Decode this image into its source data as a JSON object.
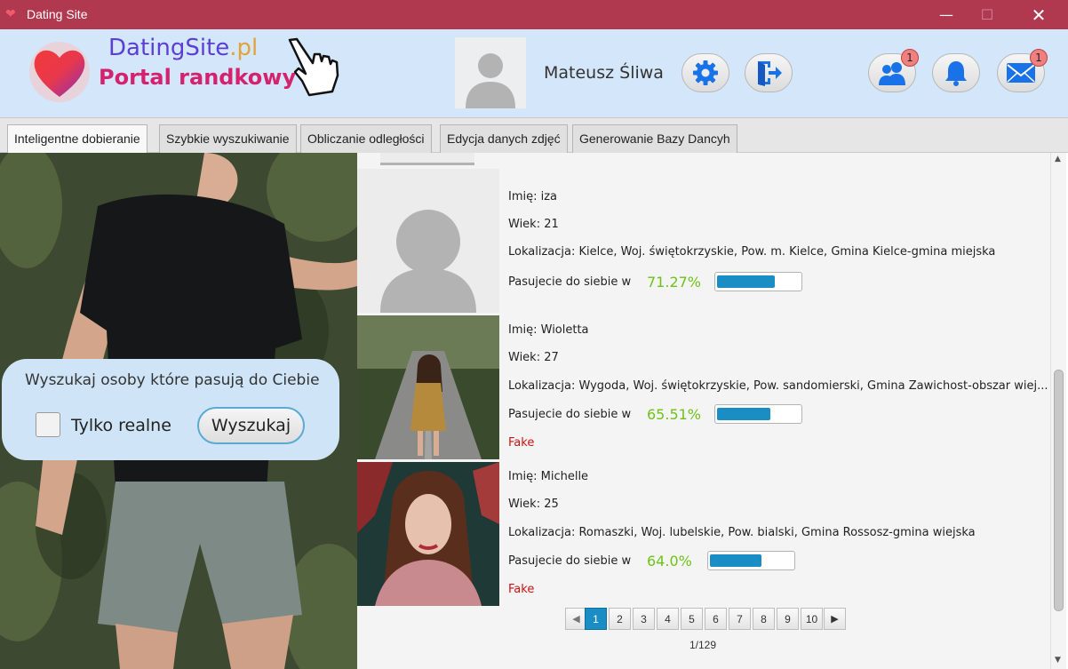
{
  "window": {
    "title": "Dating Site",
    "minimize_glyph": "—",
    "maximize_glyph": "☐",
    "close_glyph": "✕",
    "icon": "heart-icon"
  },
  "header": {
    "brand_name": "DatingSite",
    "brand_tld": ".pl",
    "brand_subtitle": "Portal randkowy",
    "user_name": "Mateusz Śliwa",
    "buttons": [
      {
        "icon": "gear-icon",
        "badge": ""
      },
      {
        "icon": "logout-icon",
        "badge": ""
      },
      {
        "icon": "users-icon",
        "badge": "1"
      },
      {
        "icon": "bell-icon",
        "badge": ""
      },
      {
        "icon": "envelope-icon",
        "badge": "1"
      }
    ],
    "colors": {
      "header_bg": "#d4e6fa",
      "titlebar_bg": "#b0394f",
      "brand_blue": "#5b3fd4",
      "brand_orange": "#e3a33b",
      "brand_pink": "#d4226e",
      "icon_blue": "#1a72e8"
    }
  },
  "tabs": [
    {
      "label": "Inteligentne dobieranie",
      "active": true
    },
    {
      "label": "Szybkie wyszukiwanie",
      "active": false
    },
    {
      "label": "Obliczanie odległości",
      "active": false
    },
    {
      "label": "Edycja danych zdjęć",
      "active": false
    },
    {
      "label": "Generowanie Bazy Dancyh",
      "active": false
    }
  ],
  "search": {
    "title": "Wyszukaj osoby które pasują do Ciebie",
    "checkbox_label": "Tylko realne",
    "checkbox_checked": false,
    "button_label": "Wyszukaj"
  },
  "results": [
    {
      "name_label": "Imię: iza",
      "age_label": "Wiek: 21",
      "location_label": "Lokalizacja: Kielce, Woj. świętokrzyskie, Pow. m. Kielce, Gmina Kielce-gmina miejska",
      "match_label": "Pasujecie do siebie w",
      "match_percent": "71.27%",
      "match_fraction": 0.7127,
      "fake_label": "",
      "photo": "placeholder-avatar"
    },
    {
      "name_label": "Imię: Wioletta",
      "age_label": "Wiek: 27",
      "location_label": "Lokalizacja: Wygoda, Woj. świętokrzyskie, Pow. sandomierski, Gmina Zawichost-obszar wiej...",
      "match_label": "Pasujecie do siebie w",
      "match_percent": "65.51%",
      "match_fraction": 0.6551,
      "fake_label": "Fake",
      "photo": "woman-on-road-photo"
    },
    {
      "name_label": "Imię: Michelle",
      "age_label": "Wiek: 25",
      "location_label": "Lokalizacja: Romaszki, Woj. lubelskie, Pow. bialski, Gmina Rossosz-gmina wiejska",
      "match_label": "Pasujecie do siebie w",
      "match_percent": "64.0%",
      "match_fraction": 0.64,
      "fake_label": "Fake",
      "photo": "woman-portrait-photo"
    }
  ],
  "pagination": {
    "prev_glyph": "◀",
    "next_glyph": "▶",
    "pages": [
      "1",
      "2",
      "3",
      "4",
      "5",
      "6",
      "7",
      "8",
      "9",
      "10"
    ],
    "current": "1",
    "page_info": "1/129"
  },
  "scroll": {
    "up_glyph": "▲",
    "down_glyph": "▼"
  }
}
